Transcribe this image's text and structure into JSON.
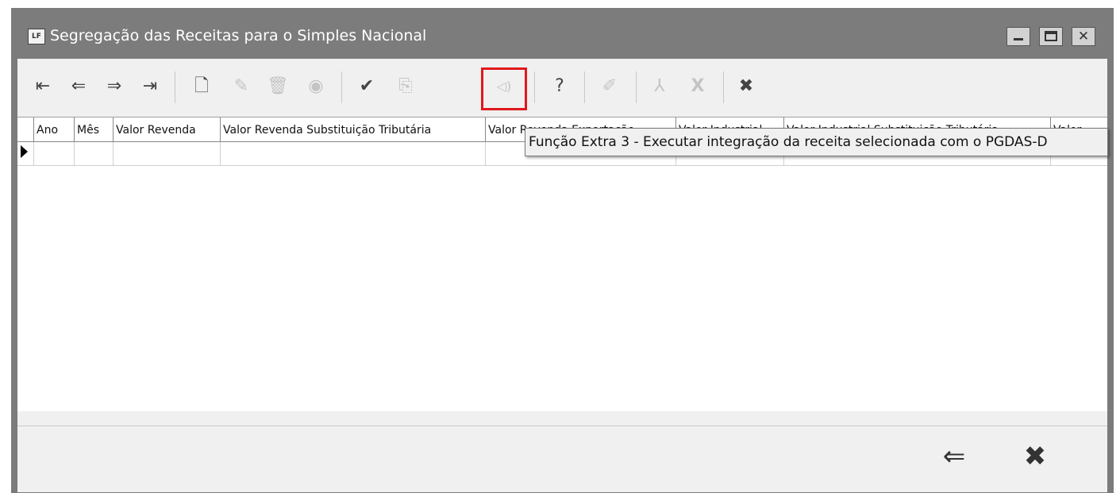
{
  "window": {
    "title": "Segregação das Receitas para o Simples Nacional",
    "icon_text": "LF",
    "minimize_glyph": "",
    "maximize_glyph": "",
    "close_glyph": "✕"
  },
  "toolbar": {
    "buttons": [
      {
        "name": "first-record",
        "icon": "⇤",
        "enabled": true
      },
      {
        "name": "previous-record",
        "icon": "⇐",
        "enabled": true
      },
      {
        "name": "next-record",
        "icon": "⇒",
        "enabled": true
      },
      {
        "name": "last-record",
        "icon": "⇥",
        "enabled": true
      },
      {
        "name": "new-record",
        "icon": "🗋",
        "enabled": true
      },
      {
        "name": "edit-record",
        "icon": "✎",
        "enabled": false
      },
      {
        "name": "delete-record",
        "icon": "🗑",
        "enabled": false
      },
      {
        "name": "view-record",
        "icon": "◉",
        "enabled": false
      },
      {
        "name": "confirm",
        "icon": "✔",
        "enabled": true
      },
      {
        "name": "extra-function-2",
        "icon": "⎘",
        "enabled": false
      },
      {
        "name": "extra-function-3",
        "icon": "◁)",
        "enabled": false
      },
      {
        "name": "help",
        "icon": "?",
        "enabled": true
      },
      {
        "name": "notes",
        "icon": "✐",
        "enabled": false
      },
      {
        "name": "export-pdf",
        "icon": "⅄",
        "enabled": false
      },
      {
        "name": "export-excel",
        "icon": "X",
        "enabled": false
      },
      {
        "name": "close",
        "icon": "✖",
        "enabled": true
      }
    ]
  },
  "grid": {
    "columns": [
      "Ano",
      "Mês",
      "Valor Revenda",
      "Valor Revenda Substituição Tributária",
      "Valor Revenda Exportação",
      "Valor Industrial",
      "Valor Industrial Substituição Tributária",
      "Valor"
    ]
  },
  "tooltip": {
    "text": "Função Extra 3 - Executar integração da receita selecionada com o PGDAS-D"
  },
  "footer": {
    "back_icon": "⇐",
    "close_icon": "✖"
  },
  "colors": {
    "highlight": "#e0191c",
    "titlebar": "#7c7c7c"
  }
}
